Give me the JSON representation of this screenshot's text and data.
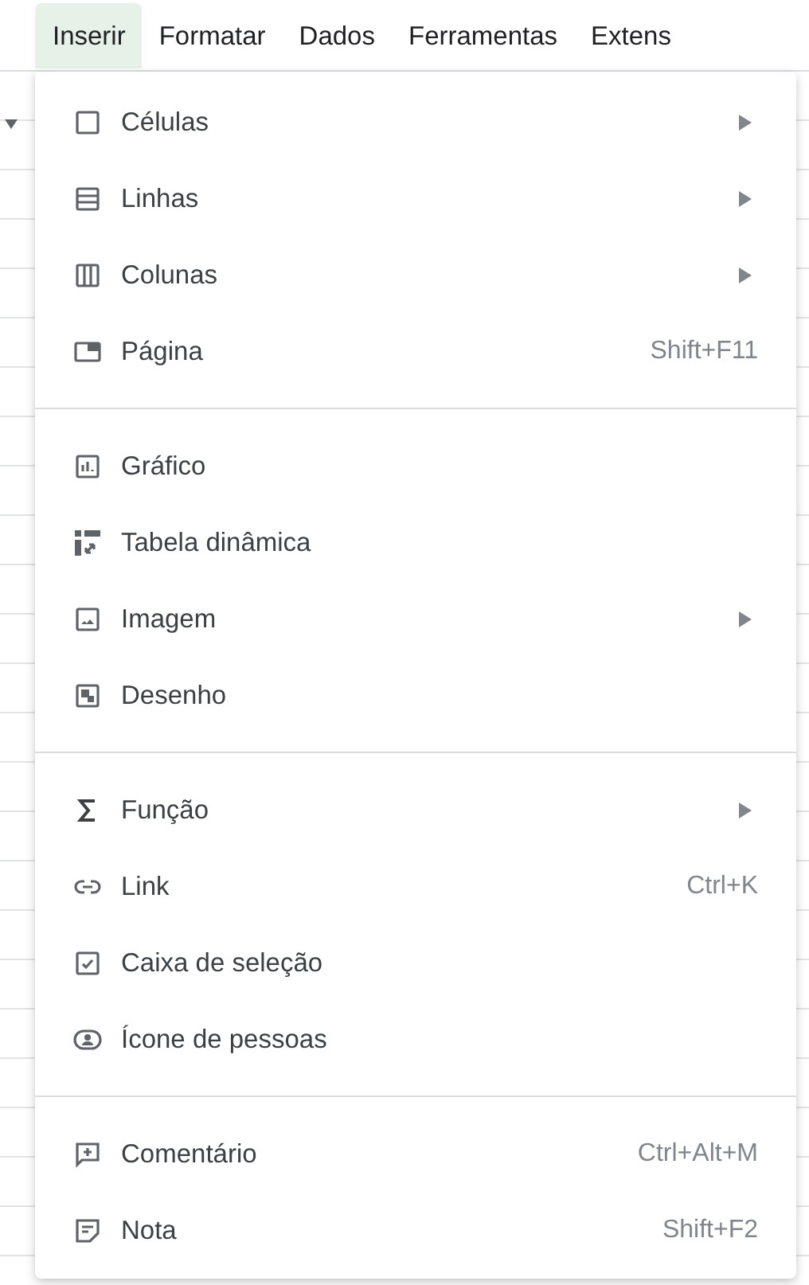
{
  "menubar": [
    {
      "label": "Inserir",
      "selected": true
    },
    {
      "label": "Formatar",
      "selected": false
    },
    {
      "label": "Dados",
      "selected": false
    },
    {
      "label": "Ferramentas",
      "selected": false
    },
    {
      "label": "Extens",
      "selected": false
    }
  ],
  "menu": {
    "sections": [
      {
        "items": [
          {
            "label": "Células",
            "submenu": true
          },
          {
            "label": "Linhas",
            "submenu": true
          },
          {
            "label": "Colunas",
            "submenu": true
          },
          {
            "label": "Página",
            "shortcut": "Shift+F11"
          }
        ]
      },
      {
        "items": [
          {
            "label": "Gráfico"
          },
          {
            "label": "Tabela dinâmica"
          },
          {
            "label": "Imagem",
            "submenu": true
          },
          {
            "label": "Desenho"
          }
        ]
      },
      {
        "items": [
          {
            "label": "Função",
            "submenu": true
          },
          {
            "label": "Link",
            "shortcut": "Ctrl+K"
          },
          {
            "label": "Caixa de seleção"
          },
          {
            "label": "Ícone de pessoas"
          }
        ]
      },
      {
        "items": [
          {
            "label": "Comentário",
            "shortcut": "Ctrl+Alt+M"
          },
          {
            "label": "Nota",
            "shortcut": "Shift+F2"
          }
        ]
      }
    ]
  }
}
